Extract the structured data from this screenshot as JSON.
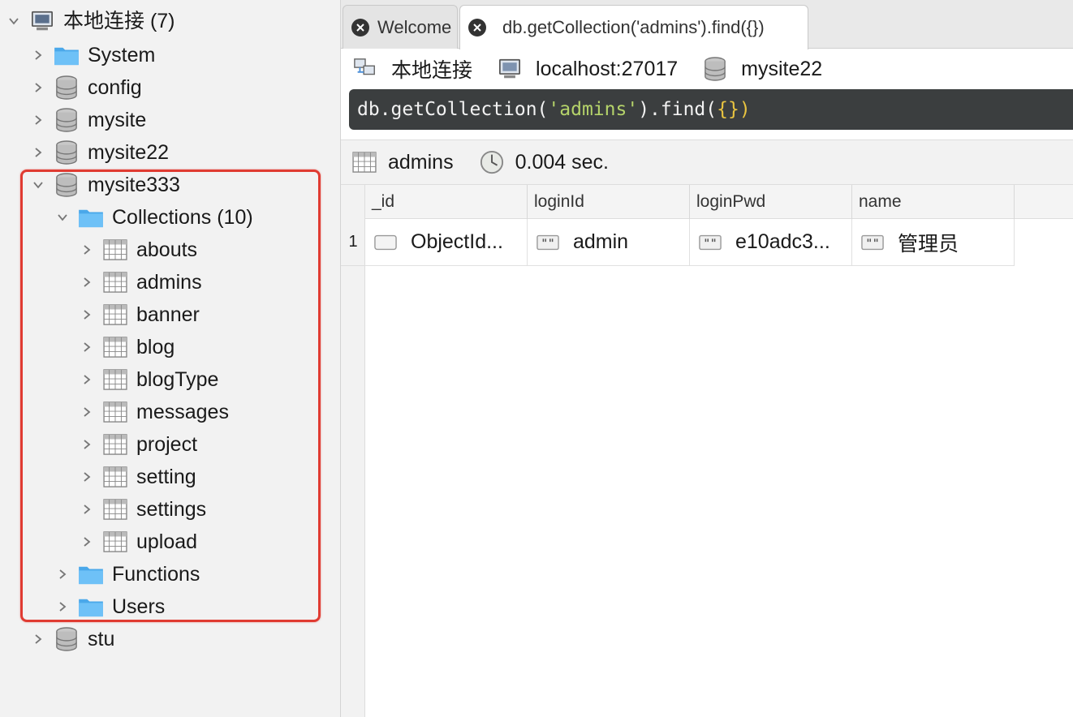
{
  "tree": {
    "connection": {
      "label": "本地连接 (7)"
    },
    "databases": [
      {
        "label": "System"
      },
      {
        "label": "config"
      },
      {
        "label": "mysite"
      },
      {
        "label": "mysite22"
      },
      {
        "label": "mysite333"
      },
      {
        "label": "stu"
      }
    ],
    "collections_folder": {
      "label": "Collections (10)"
    },
    "collections": [
      "abouts",
      "admins",
      "banner",
      "blog",
      "blogType",
      "messages",
      "project",
      "setting",
      "settings",
      "upload"
    ],
    "functions_folder": {
      "label": "Functions"
    },
    "users_folder": {
      "label": "Users"
    }
  },
  "tabs": [
    {
      "label": "Welcome"
    },
    {
      "label": "db.getCollection('admins').find({})"
    }
  ],
  "infobar": {
    "connection": "本地连接",
    "host": "localhost:27017",
    "database": "mysite22"
  },
  "query": {
    "prefix": "db.getCollection(",
    "arg": "'admins'",
    "mid": ").find(",
    "inner": "{}",
    "close": ")"
  },
  "result": {
    "collection": "admins",
    "time": "0.004 sec."
  },
  "table": {
    "columns": [
      "_id",
      "loginId",
      "loginPwd",
      "name"
    ],
    "rows": [
      {
        "num": "1",
        "cells": [
          "ObjectId...",
          "admin",
          "e10adc3...",
          "管理员"
        ]
      }
    ]
  },
  "colors": {
    "highlight": "#e03b32",
    "query_bg": "#3b3e3f",
    "query_string": "#b5d36a",
    "query_paren": "#e9c440"
  }
}
